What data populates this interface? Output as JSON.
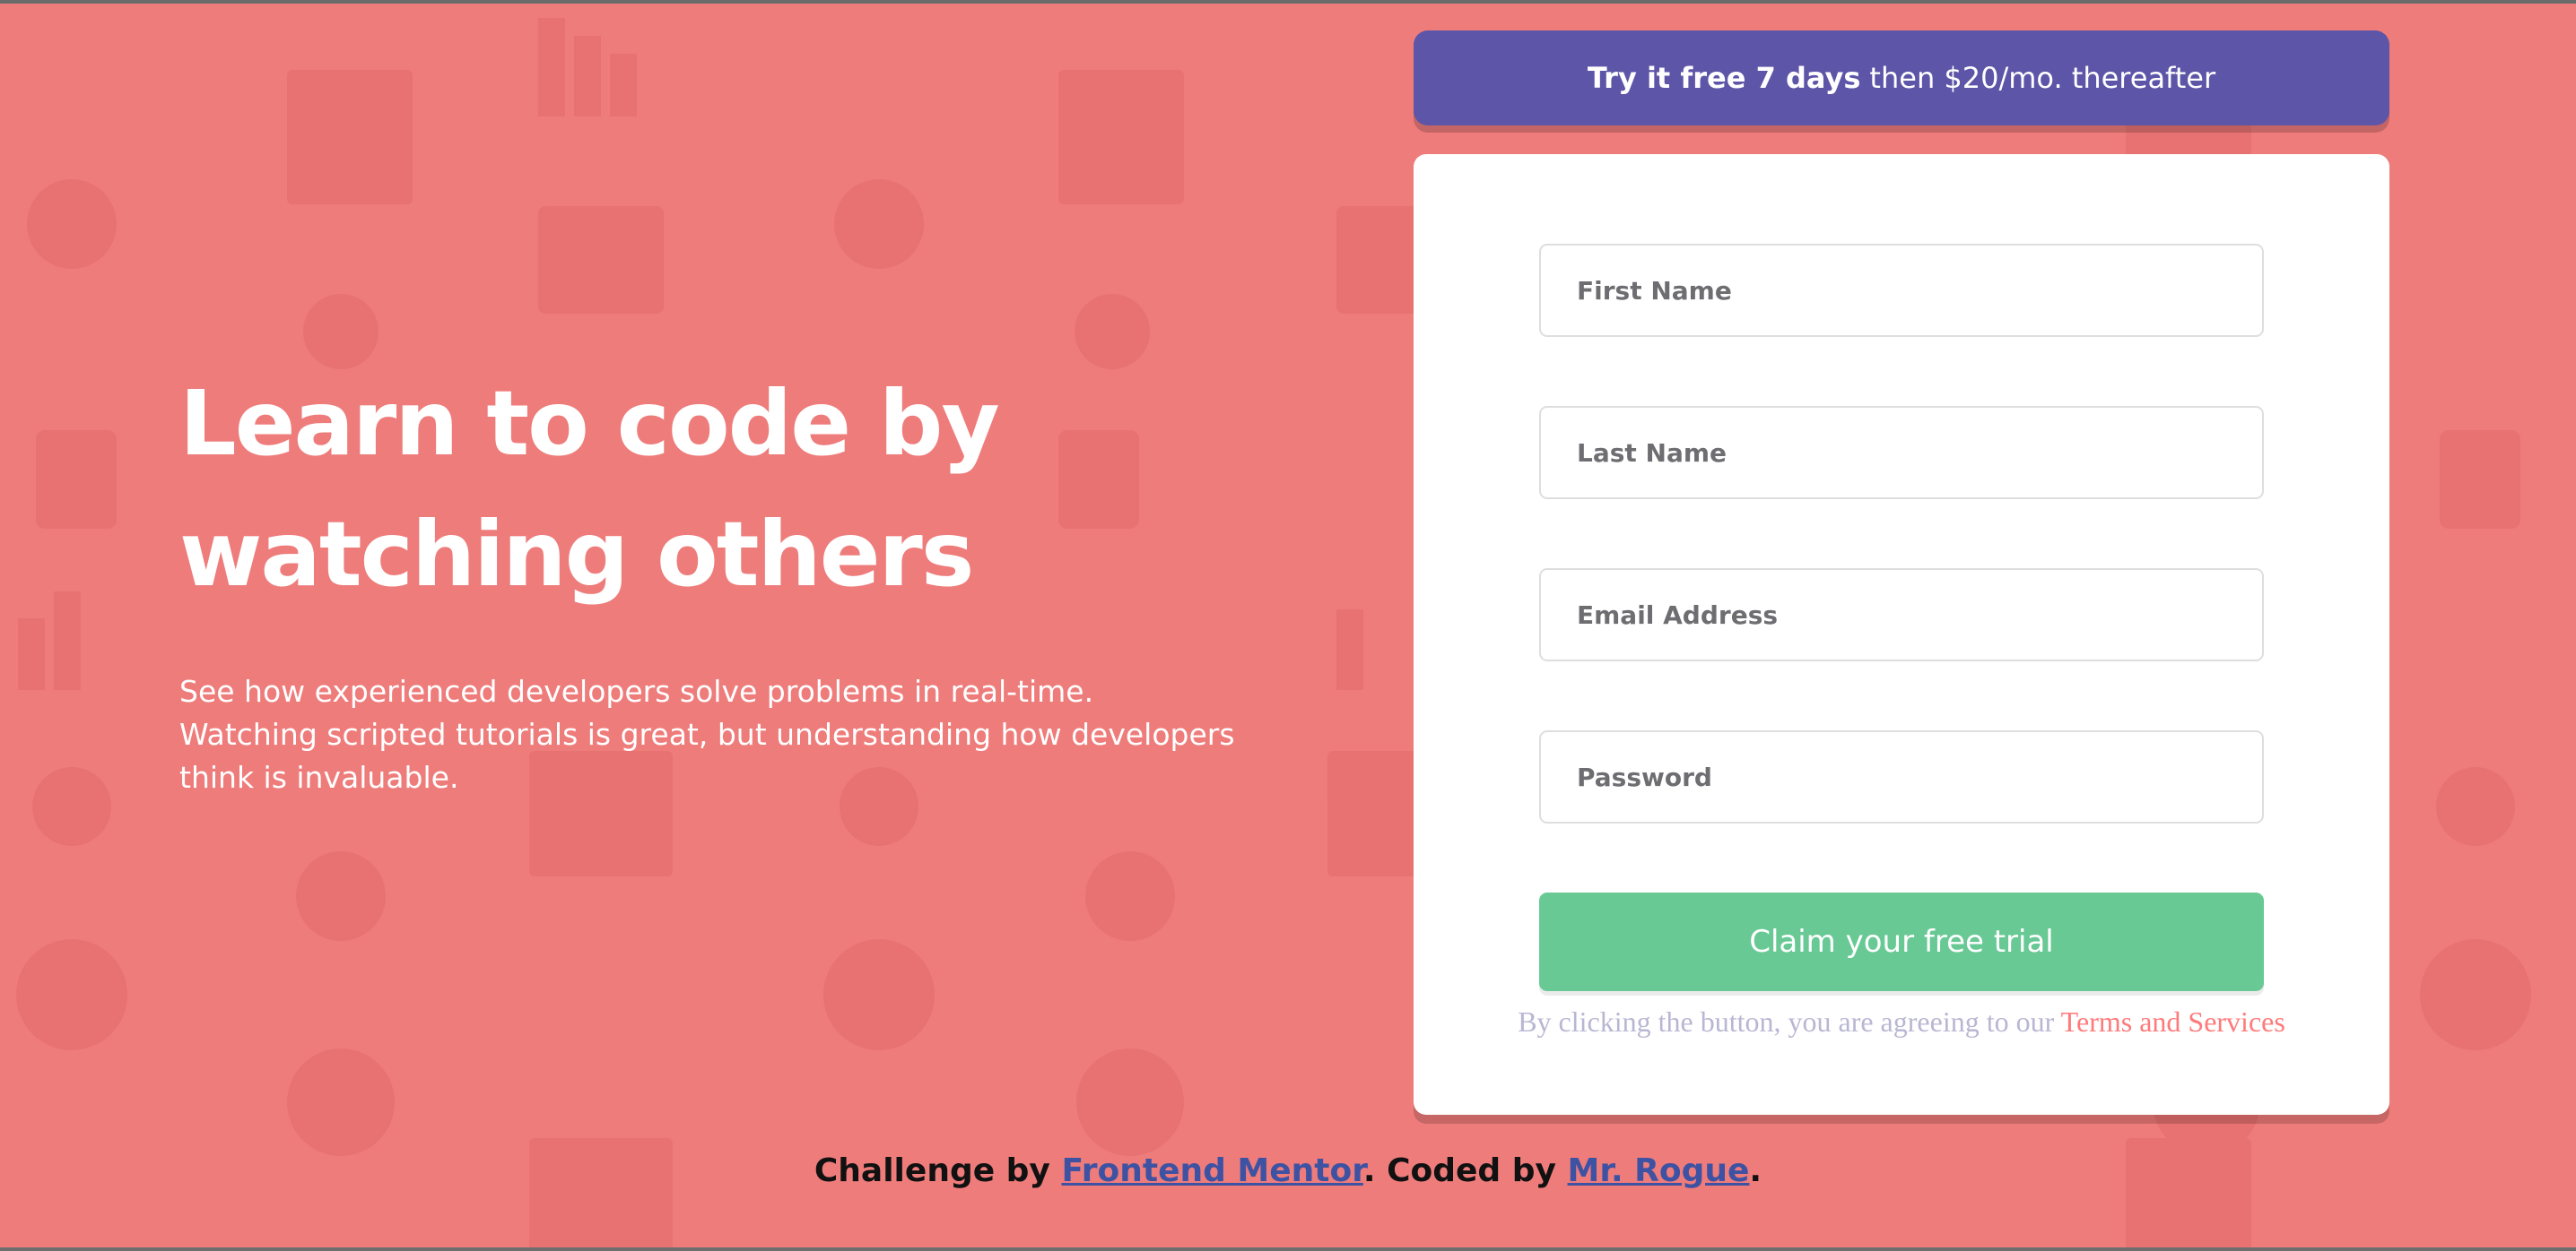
{
  "banner": {
    "bold": "Try it free 7 days",
    "rest": "then $20/mo. thereafter"
  },
  "hero": {
    "headline": "Learn to code by watching others",
    "intro": "See how experienced developers solve problems in real-time. Watching scripted tutorials is great, but understanding how developers think is invaluable."
  },
  "form": {
    "first_name_placeholder": "First Name",
    "last_name_placeholder": "Last Name",
    "email_placeholder": "Email Address",
    "password_placeholder": "Password",
    "submit_label": "Claim your free trial",
    "terms_prefix": "By clicking the button, you are agreeing to our",
    "terms_link": "Terms and Services"
  },
  "footer": {
    "prefix": "Challenge by",
    "mentor_link": "Frontend Mentor",
    "middle": ". Coded by",
    "author_link": "Mr. Rogue",
    "suffix": "."
  },
  "colors": {
    "background": "#ee7c7b",
    "banner": "#5d55a7",
    "button": "#68c995",
    "terms_link": "#ff7a7a",
    "footer_link": "#3e52a3"
  },
  "icons": [
    "browser-icon",
    "toolbox-icon",
    "network-icon",
    "thumbs-up-icon",
    "rocket-icon",
    "headset-icon",
    "chart-icon",
    "cart-icon",
    "globe-icon",
    "lifebuoy-icon"
  ]
}
